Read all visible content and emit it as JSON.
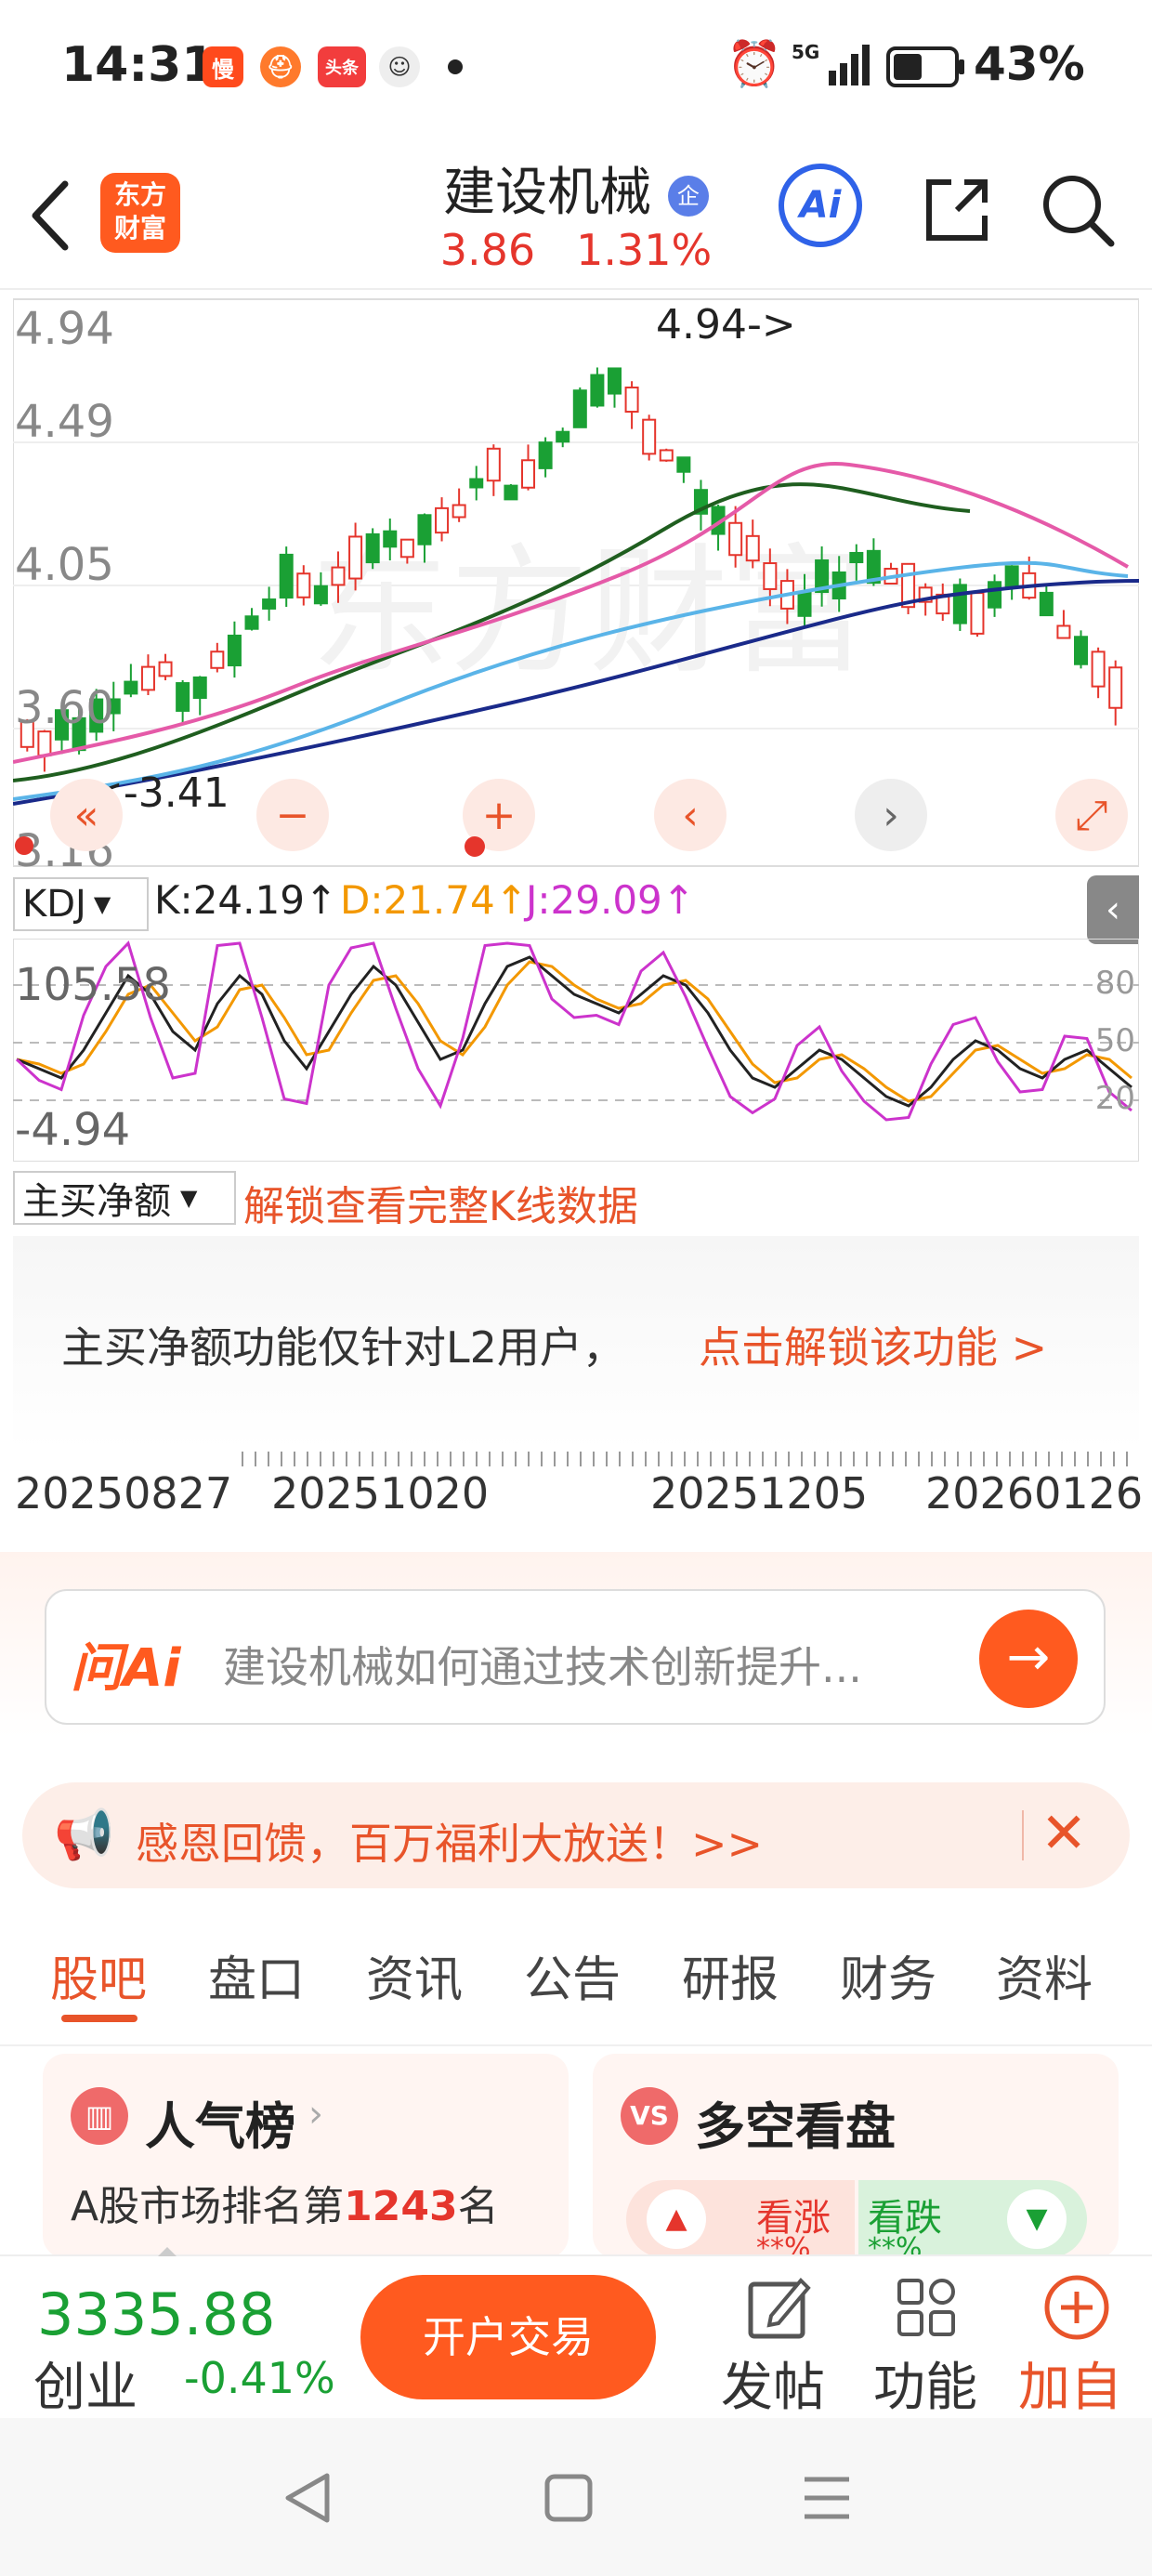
{
  "status_bar": {
    "time": "14:31",
    "apps": [
      "慢",
      "头条"
    ],
    "network": "5G",
    "battery": "43%"
  },
  "header": {
    "title": "建设机械",
    "badge": "企",
    "price": "3.86",
    "change": "1.31%",
    "logo_line1": "东方",
    "logo_line2": "财富",
    "ai_label": "Ai",
    "icons": [
      "back-icon",
      "share-icon",
      "search-icon"
    ]
  },
  "kline": {
    "y_labels": [
      "4.94",
      "4.49",
      "4.05",
      "3.60",
      "3.16"
    ],
    "high_marker": "4.94->",
    "low_marker": "<-3.41",
    "watermark": "东方财富",
    "buttons": [
      "«",
      "−",
      "+",
      "‹",
      "›",
      "⤢"
    ]
  },
  "kdj": {
    "indicator": "KDJ",
    "k": "K:24.19↑",
    "d": "D:21.74↑",
    "j": "J:29.09↑",
    "y_top": "105.58",
    "y_bottom": "-4.94",
    "levels": [
      "80",
      "50",
      "20"
    ],
    "colors": {
      "k": "#222222",
      "d": "#f39800",
      "j": "#cc33cc"
    }
  },
  "net_buy": {
    "indicator": "主买净额",
    "unlock_text": "解锁查看完整K线数据",
    "info": "主买净额功能仅针对L2用户，",
    "info_link": "点击解锁该功能 >"
  },
  "dates": [
    "20250827",
    "20251020",
    "20251205",
    "20260126"
  ],
  "ai_search": {
    "logo": "问Ai",
    "placeholder": "建设机械如何通过技术创新提升..."
  },
  "promo": {
    "text": "感恩回馈，百万福利大放送！>>"
  },
  "tabs": [
    "股吧",
    "盘口",
    "资讯",
    "公告",
    "研报",
    "财务",
    "资料"
  ],
  "active_tab": 0,
  "cards": {
    "popularity": {
      "title": "人气榜",
      "rank_prefix": "A股市场排名第",
      "rank": "1243",
      "rank_suffix": "名"
    },
    "bull_bear": {
      "title": "多空看盘",
      "bull": "看涨",
      "bear": "看跌",
      "bull_pct": "**%",
      "bear_pct": "**%"
    }
  },
  "bottom_bar": {
    "index_value": "3335.88",
    "index_name": "创业",
    "index_change": "-0.41%",
    "trade_button": "开户交易",
    "post": "发帖",
    "functions": "功能",
    "add": "加自"
  },
  "colors": {
    "up": "#e5352c",
    "down": "#1aa034",
    "accent": "#ff5a1f",
    "ma5": "#e55aa8",
    "ma10": "#1f5e1f",
    "ma20": "#5ab4e8",
    "ma60": "#1a2a8a"
  }
}
